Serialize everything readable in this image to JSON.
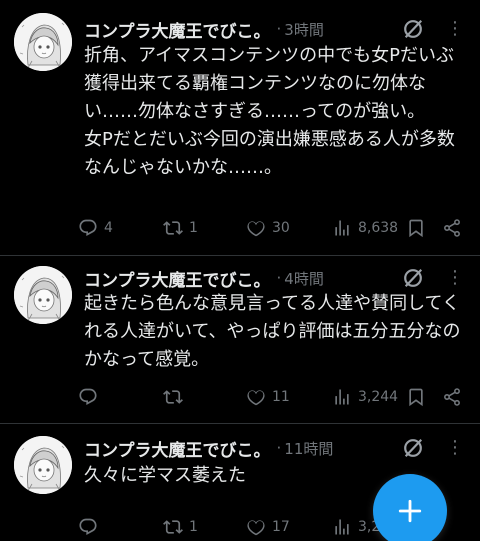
{
  "tweets": [
    {
      "name": "コンプラ大魔王でびこ。",
      "separator": "·",
      "time": "3時間",
      "text": "折角、アイマスコンテンツの中でも女Pだいぶ獲得出来てる覇権コンテンツなのに勿体ない……勿体なさすぎる……ってのが強い。\n女Pだとだいぶ今回の演出嫌悪感ある人が多数なんじゃないかな……。",
      "replies": "4",
      "reposts": "1",
      "likes": "30",
      "views": "8,638"
    },
    {
      "name": "コンプラ大魔王でびこ。",
      "separator": "·",
      "time": "4時間",
      "text": "起きたら色んな意見言ってる人達や賛同してくれる人達がいて、やっぱり評価は五分五分なのかなって感覚。",
      "replies": "",
      "reposts": "",
      "likes": "11",
      "views": "3,244"
    },
    {
      "name": "コンプラ大魔王でびこ。",
      "separator": "·",
      "time": "11時間",
      "text": "久々に学マス萎えた",
      "replies": "",
      "reposts": "1",
      "likes": "17",
      "views": "3,2"
    }
  ],
  "icons": {
    "reply": "reply-icon",
    "repost": "repost-icon",
    "like": "heart-icon",
    "views": "views-chart-icon",
    "bookmark": "bookmark-icon",
    "share": "share-icon",
    "grok": "grok-icon",
    "more": "more-icon",
    "compose": "plus-icon"
  },
  "colors": {
    "background": "#000000",
    "text": "#e7e9ea",
    "muted": "#71767b",
    "accent": "#1d9bf0",
    "divider": "#2f3336"
  }
}
